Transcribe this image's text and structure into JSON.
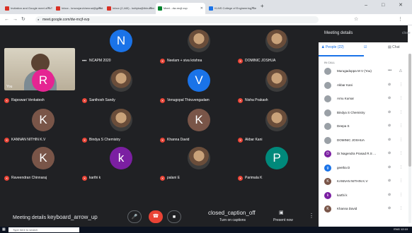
{
  "browser": {
    "tabs": [
      {
        "title": "Invitation and Google meet of IoT F…",
        "color": "#d93025"
      },
      {
        "title": "Inbox - kmcrujan/chennai@gmail.com – G…",
        "color": "#d93025"
      },
      {
        "title": "Inbox (2,440) - kuttyka@thirumeet.in",
        "color": "#d93025"
      },
      {
        "title": "Meet - dw-mcjf-xvp",
        "color": "#00832d"
      },
      {
        "title": "KLNS College of Engineering, Bengal…",
        "color": "#1a73e8"
      }
    ],
    "new_tab": "+",
    "window_controls": "–  □  ✕",
    "url": "meet.google.com/dw-mcjf-xvp"
  },
  "self_tile": {
    "name": "You"
  },
  "tiles": [
    {
      "name": "NCAPM 2020",
      "initial": "N",
      "color": "#1a73e8",
      "photo": false,
      "muted": false
    },
    {
      "name": "Neelam + siva krishna",
      "initial": "",
      "color": "#9aa0a6",
      "photo": true,
      "muted": true
    },
    {
      "name": "DOMINIC JOSHUA",
      "initial": "",
      "color": "#9aa0a6",
      "photo": true,
      "muted": true
    },
    {
      "name": "Rajeswari Venkatesh",
      "initial": "R",
      "color": "#e52592",
      "photo": false,
      "muted": true
    },
    {
      "name": "Santhosh Sandy",
      "initial": "",
      "color": "#9aa0a6",
      "photo": true,
      "muted": true
    },
    {
      "name": "Venugopal Thiruvengadam",
      "initial": "V",
      "color": "#1a73e8",
      "photo": false,
      "muted": true
    },
    {
      "name": "Nisha Prakash",
      "initial": "",
      "color": "#9aa0a6",
      "photo": true,
      "muted": true
    },
    {
      "name": "KANNAN NITHIN K.V",
      "initial": "K",
      "color": "#795548",
      "photo": false,
      "muted": true
    },
    {
      "name": "Bindya S Chemistry",
      "initial": "",
      "color": "#9aa0a6",
      "photo": true,
      "muted": true
    },
    {
      "name": "Khanna David",
      "initial": "K",
      "color": "#795548",
      "photo": false,
      "muted": true
    },
    {
      "name": "Akbar Kani",
      "initial": "",
      "color": "#9aa0a6",
      "photo": true,
      "muted": true
    },
    {
      "name": "Raveendran Chinnaraj",
      "initial": "K",
      "color": "#795548",
      "photo": false,
      "muted": true
    },
    {
      "name": "karthi k",
      "initial": "k",
      "color": "#7b1fa2",
      "photo": false,
      "muted": true
    },
    {
      "name": "palani E",
      "initial": "",
      "color": "#9aa0a6",
      "photo": true,
      "muted": true
    },
    {
      "name": "Parimala K",
      "initial": "P",
      "color": "#00897b",
      "photo": false,
      "muted": true
    }
  ],
  "bottom_bar": {
    "meeting_details": "Meeting details",
    "meeting_details_icon": "keyboard_arrow_up",
    "captions_icon": "closed_caption_off",
    "captions_label": "Turn on captions",
    "present_label": "Present now"
  },
  "panel": {
    "title": "Meeting details",
    "close_icon": "close",
    "tab_people": "People (22)",
    "tab_chat": "Chat",
    "in_call_label": "IN CALL",
    "participants": [
      {
        "name": "Murugadoppa M V (You)",
        "color": "#9aa0a6",
        "initial": ""
      },
      {
        "name": "Akbar Kani",
        "color": "#9aa0a6",
        "initial": ""
      },
      {
        "name": "Arnu Kumar",
        "color": "#9aa0a6",
        "initial": ""
      },
      {
        "name": "Bindya S Chemistry",
        "color": "#9aa0a6",
        "initial": ""
      },
      {
        "name": "Deepa S",
        "color": "#9aa0a6",
        "initial": ""
      },
      {
        "name": "DOMINIC JOSHUA",
        "color": "#9aa0a6",
        "initial": ""
      },
      {
        "name": "Dr.Nagendra Prasad R.S …",
        "color": "#7b1fa2",
        "initial": "D"
      },
      {
        "name": "geetha D",
        "color": "#1a73e8",
        "initial": "g"
      },
      {
        "name": "KANNAN NITHIN K.V",
        "color": "#795548",
        "initial": "K"
      },
      {
        "name": "karthi k",
        "color": "#7b1fa2",
        "initial": "k"
      },
      {
        "name": "Khanna David",
        "color": "#795548",
        "initial": "K"
      }
    ]
  },
  "taskbar": {
    "search_placeholder": "Type here to search",
    "tray_text": "ENG  12:10"
  }
}
